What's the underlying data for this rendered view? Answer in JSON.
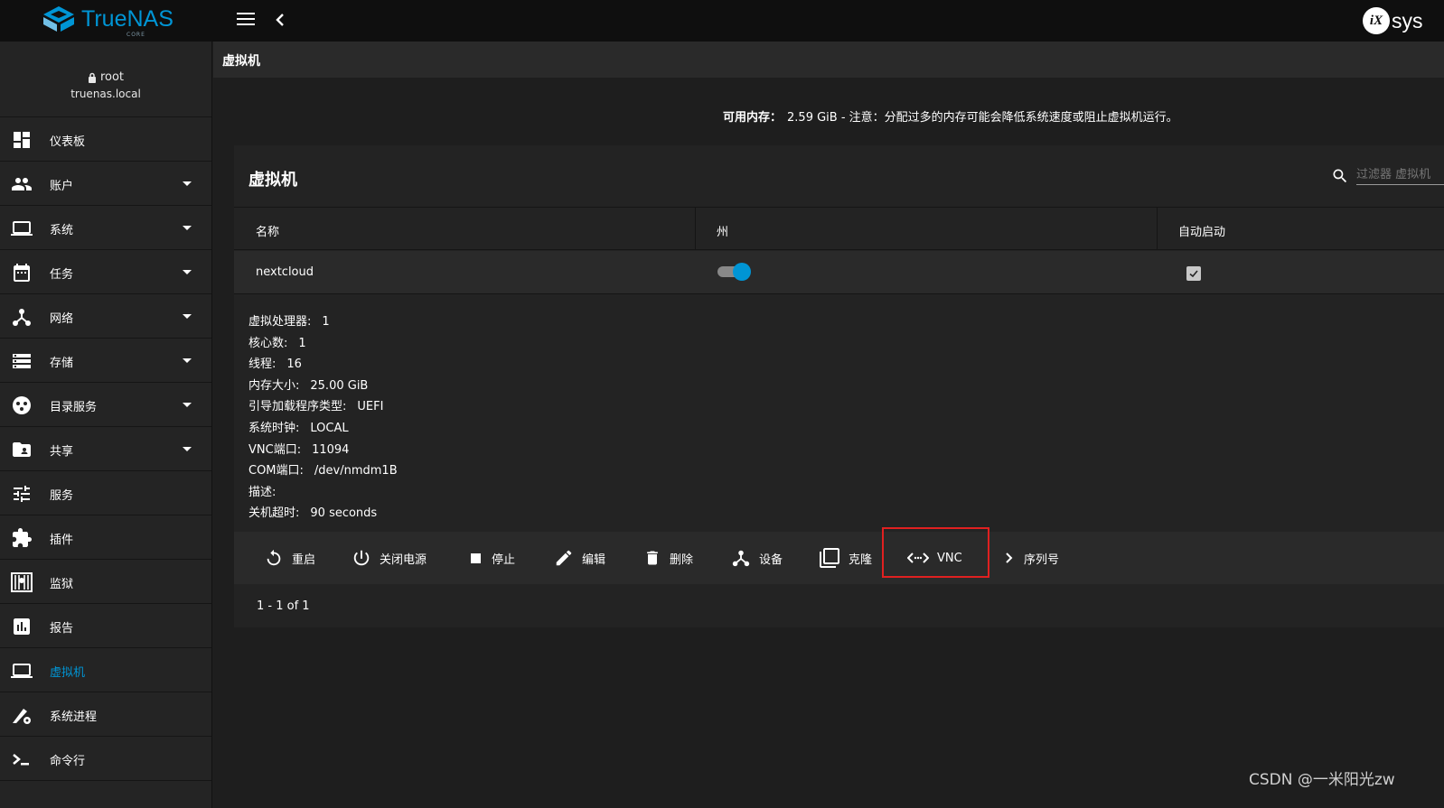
{
  "app": {
    "brand_name": "TrueNAS",
    "brand_sub": "CORE",
    "vendor": "sys",
    "vendor_mark": "iX",
    "brand_color": "#0095d5"
  },
  "user": {
    "name": "root",
    "host": "truenas.local"
  },
  "sidebar": {
    "items": [
      {
        "label": "仪表板",
        "icon": "dashboard-icon"
      },
      {
        "label": "账户",
        "icon": "people-icon"
      },
      {
        "label": "系统",
        "icon": "laptop-icon"
      },
      {
        "label": "任务",
        "icon": "calendar-icon"
      },
      {
        "label": "网络",
        "icon": "network-icon"
      },
      {
        "label": "存储",
        "icon": "storage-icon"
      },
      {
        "label": "目录服务",
        "icon": "directory-icon"
      },
      {
        "label": "共享",
        "icon": "folder-share-icon"
      },
      {
        "label": "服务",
        "icon": "tune-icon"
      },
      {
        "label": "插件",
        "icon": "puzzle-icon"
      },
      {
        "label": "监狱",
        "icon": "jail-icon"
      },
      {
        "label": "报告",
        "icon": "chart-icon"
      },
      {
        "label": "虚拟机",
        "icon": "vm-icon"
      },
      {
        "label": "系统进程",
        "icon": "system-process-icon"
      },
      {
        "label": "命令行",
        "icon": "terminal-icon"
      }
    ]
  },
  "breadcrumb": "虚拟机",
  "memory_note": {
    "label": "可用内存：",
    "value": "2.59 GiB",
    "note": " - 注意：分配过多的内存可能会降低系统速度或阻止虚拟机运行。"
  },
  "card": {
    "title": "虚拟机",
    "filter_placeholder": "过滤器 虚拟机"
  },
  "table": {
    "columns": [
      "名称",
      "州",
      "自动启动"
    ],
    "rows": [
      {
        "name": "nextcloud",
        "state_on": true,
        "autostart": true
      }
    ]
  },
  "details": [
    {
      "label": "虚拟处理器:",
      "value": "1"
    },
    {
      "label": "核心数:",
      "value": "1"
    },
    {
      "label": "线程:",
      "value": "16"
    },
    {
      "label": "内存大小:",
      "value": "25.00 GiB"
    },
    {
      "label": "引导加载程序类型:",
      "value": "UEFI"
    },
    {
      "label": "系统时钟:",
      "value": "LOCAL"
    },
    {
      "label": "VNC端口:",
      "value": "11094"
    },
    {
      "label": "COM端口:",
      "value": "/dev/nmdm1B"
    },
    {
      "label": "描述:",
      "value": ""
    },
    {
      "label": "关机超时:",
      "value": "90 seconds"
    }
  ],
  "actions": [
    {
      "label": "重启",
      "icon": "restart-icon"
    },
    {
      "label": "关闭电源",
      "icon": "power-icon"
    },
    {
      "label": "停止",
      "icon": "stop-icon"
    },
    {
      "label": "编辑",
      "icon": "edit-icon"
    },
    {
      "label": "删除",
      "icon": "delete-icon"
    },
    {
      "label": "设备",
      "icon": "devices-icon"
    },
    {
      "label": "克隆",
      "icon": "clone-icon"
    },
    {
      "label": "VNC",
      "icon": "vnc-icon"
    },
    {
      "label": "序列号",
      "icon": "chevron-right-icon"
    }
  ],
  "pager": "1 - 1 of 1",
  "watermark": "CSDN @一米阳光zw"
}
